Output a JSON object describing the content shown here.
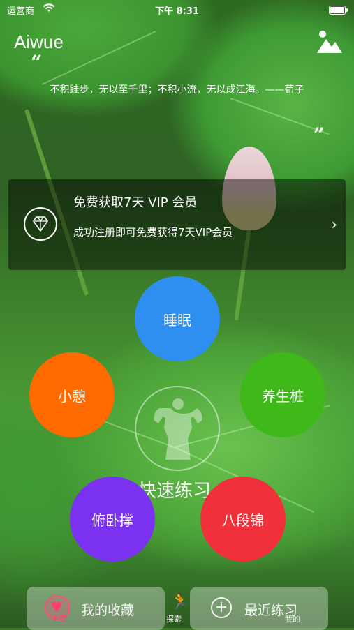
{
  "status_bar": {
    "carrier": "运营商",
    "time": "下午 8:31"
  },
  "header": {
    "app_name": "Aiwue",
    "image_button_icon": "image-icon"
  },
  "quote": {
    "open_mark": "“",
    "text": "不积跬步，无以至千里；不积小流，无以成江海。——荀子",
    "close_mark": "”"
  },
  "vip_banner": {
    "title": "免费获取7天 VIP 会员",
    "subtitle": "成功注册即可免费获得7天VIP会员",
    "icon": "diamond-icon",
    "chevron": "›"
  },
  "practice": {
    "center_label": "快速练习",
    "center_icon": "muscle-figure-icon",
    "items": [
      {
        "label": "睡眠",
        "color": "#2f8ff0"
      },
      {
        "label": "小憩",
        "color": "#ff6a00"
      },
      {
        "label": "养生桩",
        "color": "#3fb81a"
      },
      {
        "label": "俯卧撑",
        "color": "#7b32f0"
      },
      {
        "label": "八段锦",
        "color": "#f0303a"
      }
    ]
  },
  "bottom": {
    "favorites_label": "我的收藏",
    "recent_label": "最近练习",
    "tabs": [
      {
        "label": "主页",
        "icon": "heart-icon",
        "color": "#ff3d6e"
      },
      {
        "label": "探索",
        "icon": "running-icon"
      },
      {
        "label": "我的",
        "icon": "user-icon"
      }
    ]
  }
}
